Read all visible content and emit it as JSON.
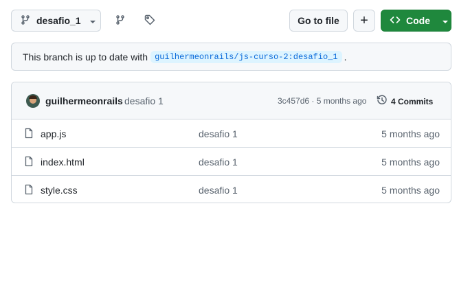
{
  "toolbar": {
    "branch_label": "desafio_1",
    "go_to_file_label": "Go to file",
    "plus_label": "+",
    "code_label": "Code"
  },
  "banner": {
    "prefix": "This branch is up to date with",
    "ref": "guilhermeonrails/js-curso-2:desafio_1",
    "suffix": "."
  },
  "latest_commit": {
    "author": "guilhermeonrails",
    "message": "desafio 1",
    "sha_time": "3c457d6 · 5 months ago",
    "commits_label": "4 Commits"
  },
  "files": [
    {
      "name": "app.js",
      "message": "desafio 1",
      "time": "5 months ago"
    },
    {
      "name": "index.html",
      "message": "desafio 1",
      "time": "5 months ago"
    },
    {
      "name": "style.css",
      "message": "desafio 1",
      "time": "5 months ago"
    }
  ],
  "colors": {
    "accent_green": "#1f883d",
    "link_blue": "#0969da",
    "border": "#d0d7de",
    "muted": "#59636e"
  }
}
